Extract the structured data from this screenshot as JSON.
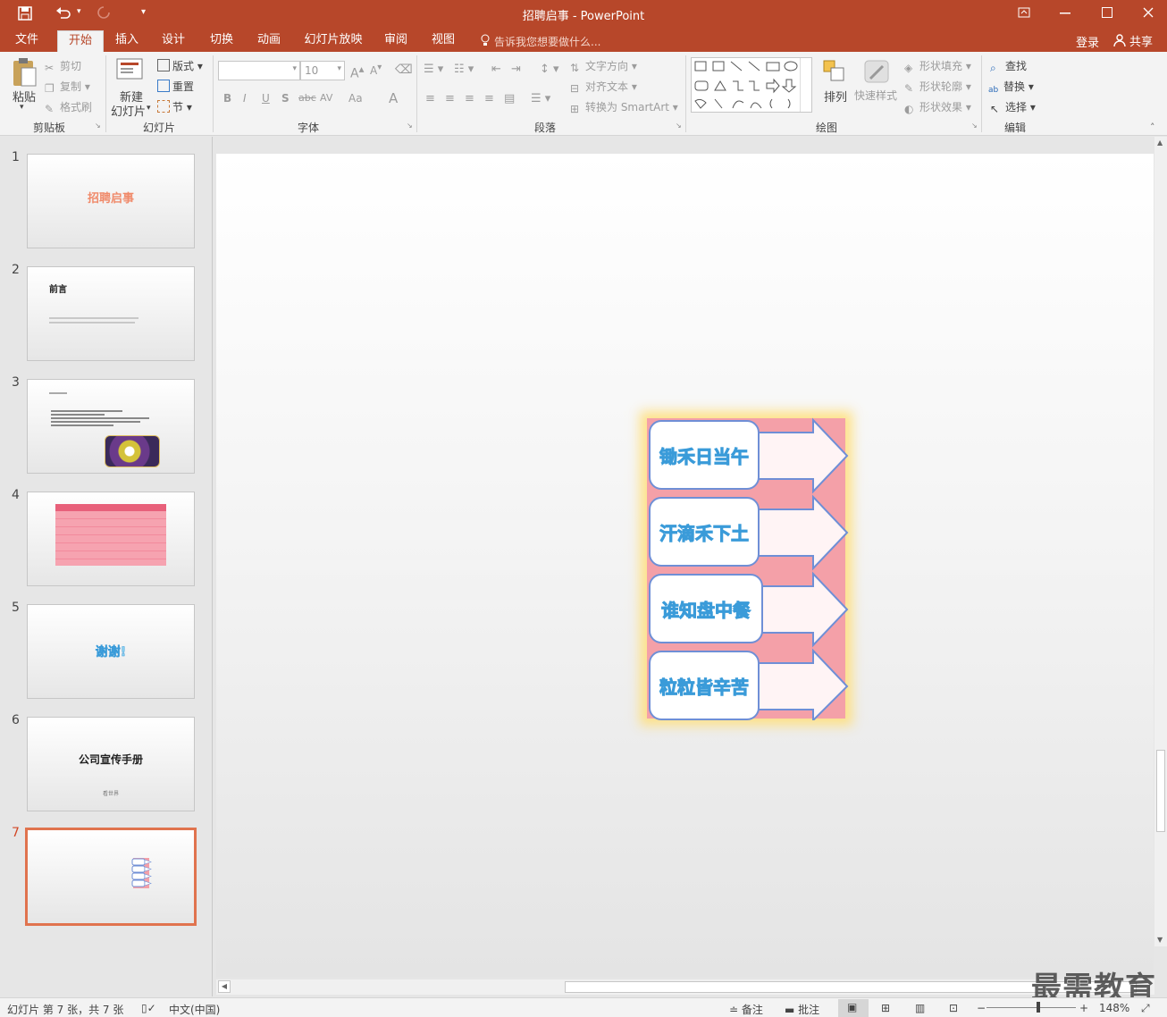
{
  "titlebar": {
    "title": "招聘启事 - PowerPoint",
    "quick_access": [
      "save-icon",
      "undo-icon",
      "redo-icon",
      "customize-icon"
    ],
    "window_buttons": [
      "restore-ribbon-icon",
      "minimize-icon",
      "maximize-icon",
      "close-icon"
    ]
  },
  "tabs": [
    {
      "label": "文件"
    },
    {
      "label": "开始"
    },
    {
      "label": "插入"
    },
    {
      "label": "设计"
    },
    {
      "label": "切换"
    },
    {
      "label": "动画"
    },
    {
      "label": "幻灯片放映"
    },
    {
      "label": "审阅"
    },
    {
      "label": "视图"
    }
  ],
  "tell_me": "告诉我您想要做什么...",
  "account": {
    "login": "登录",
    "share": "共享"
  },
  "ribbon": {
    "clipboard": {
      "paste": "粘贴",
      "cut": "剪切",
      "copy": "复制",
      "format_painter": "格式刷",
      "label": "剪贴板"
    },
    "slides": {
      "new_slide_1": "新建",
      "new_slide_2": "幻灯片",
      "layout": "版式",
      "reset": "重置",
      "section": "节",
      "label": "幻灯片"
    },
    "font": {
      "font_size": "10",
      "label": "字体",
      "bold": "B",
      "italic": "I",
      "underline": "U",
      "shadow": "S",
      "strike": "abc",
      "spacing": "AV",
      "case": "Aa",
      "color": "A"
    },
    "paragraph": {
      "text_direction": "文字方向",
      "align_text": "对齐文本",
      "convert_smartart": "转换为 SmartArt",
      "label": "段落"
    },
    "drawing": {
      "arrange": "排列",
      "quick_styles": "快速样式",
      "shape_fill": "形状填充",
      "shape_outline": "形状轮廓",
      "shape_effects": "形状效果",
      "label": "绘图"
    },
    "editing": {
      "find": "查找",
      "replace": "替换",
      "select": "选择",
      "label": "编辑"
    }
  },
  "slides": [
    {
      "num": "1",
      "title": "招聘启事"
    },
    {
      "num": "2",
      "title": "前言"
    },
    {
      "num": "3",
      "title": ""
    },
    {
      "num": "4",
      "title": ""
    },
    {
      "num": "5",
      "title": "谢谢!"
    },
    {
      "num": "6",
      "title": "公司宣传手册",
      "subtitle": "看世界"
    },
    {
      "num": "7",
      "title": ""
    }
  ],
  "slide_content": {
    "lines": [
      "锄禾日当午",
      "汗滴禾下土",
      "谁知盘中餐",
      "粒粒皆辛苦"
    ]
  },
  "status": {
    "slide_info": "幻灯片 第 7 张，共 7 张",
    "language": "中文(中国)",
    "notes": "备注",
    "comments": "批注",
    "zoom": "148%"
  },
  "watermark": "最需教育",
  "colors": {
    "accent": "#b7472a",
    "slide_bg": "#f4a0a8",
    "text_fill": "#8fd2f0",
    "box_border": "#6f8fd6"
  }
}
